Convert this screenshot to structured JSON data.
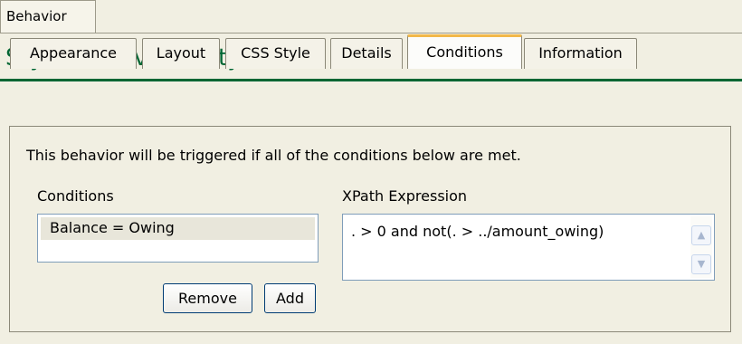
{
  "outer_tab": {
    "label": "Behavior"
  },
  "page_title": "Style Behavior - Style",
  "tabs": [
    {
      "label": "Appearance"
    },
    {
      "label": "Layout"
    },
    {
      "label": "CSS Style"
    },
    {
      "label": "Details"
    },
    {
      "label": "Conditions",
      "active": true
    },
    {
      "label": "Information"
    }
  ],
  "panel": {
    "intro": "This behavior will be triggered if all of the conditions below are met.",
    "conditions": {
      "label": "Conditions",
      "items": [
        "Balance = Owing"
      ]
    },
    "xpath": {
      "label": "XPath Expression",
      "value": ". > 0 and not(. > ../amount_owing)"
    },
    "buttons": {
      "remove": "Remove",
      "add": "Add"
    }
  },
  "colors": {
    "title": "#006633",
    "active_tab_accent": "#f2b84a",
    "panel_background": "#f1efe2"
  },
  "icons": {
    "scroll_up": "scroll-up-arrow-icon",
    "scroll_down": "scroll-down-arrow-icon"
  }
}
